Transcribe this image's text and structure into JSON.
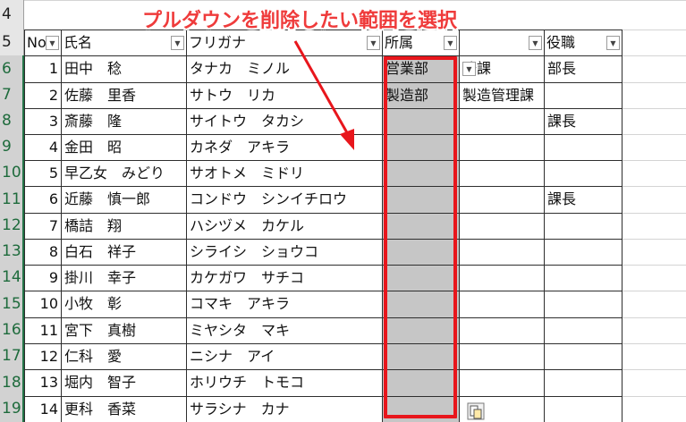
{
  "annotation": {
    "text": "プルダウンを削除したい範囲を選択",
    "color": "#e8161c"
  },
  "row_numbers": [
    "4",
    "5",
    "6",
    "7",
    "8",
    "9",
    "10",
    "11",
    "12",
    "13",
    "14",
    "15",
    "16",
    "17",
    "18",
    "19"
  ],
  "header": {
    "no": "No",
    "name": "氏名",
    "furigana": "フリガナ",
    "dept": "所属",
    "section": "",
    "title": "役職"
  },
  "rows": [
    {
      "no": "1",
      "name": "田中　稔",
      "kana": "タナカ　ミノル",
      "dept": "営業部",
      "section": "務課",
      "title": "部長"
    },
    {
      "no": "2",
      "name": "佐藤　里香",
      "kana": "サトウ　リカ",
      "dept": "製造部",
      "section": "製造管理課",
      "title": ""
    },
    {
      "no": "3",
      "name": "斎藤　隆",
      "kana": "サイトウ　タカシ",
      "dept": "",
      "section": "",
      "title": "課長"
    },
    {
      "no": "4",
      "name": "金田　昭",
      "kana": "カネダ　アキラ",
      "dept": "",
      "section": "",
      "title": ""
    },
    {
      "no": "5",
      "name": "早乙女　みどり",
      "kana": "サオトメ　ミドリ",
      "dept": "",
      "section": "",
      "title": ""
    },
    {
      "no": "6",
      "name": "近藤　慎一郎",
      "kana": "コンドウ　シンイチロウ",
      "dept": "",
      "section": "",
      "title": "課長"
    },
    {
      "no": "7",
      "name": "橋詰　翔",
      "kana": "ハシヅメ　カケル",
      "dept": "",
      "section": "",
      "title": ""
    },
    {
      "no": "8",
      "name": "白石　祥子",
      "kana": "シライシ　ショウコ",
      "dept": "",
      "section": "",
      "title": ""
    },
    {
      "no": "9",
      "name": "掛川　幸子",
      "kana": "カケガワ　サチコ",
      "dept": "",
      "section": "",
      "title": ""
    },
    {
      "no": "10",
      "name": "小牧　彰",
      "kana": "コマキ　アキラ",
      "dept": "",
      "section": "",
      "title": ""
    },
    {
      "no": "11",
      "name": "宮下　真樹",
      "kana": "ミヤシタ　マキ",
      "dept": "",
      "section": "",
      "title": ""
    },
    {
      "no": "12",
      "name": "仁科　愛",
      "kana": "ニシナ　アイ",
      "dept": "",
      "section": "",
      "title": ""
    },
    {
      "no": "13",
      "name": "堀内　智子",
      "kana": "ホリウチ　トモコ",
      "dept": "",
      "section": "",
      "title": ""
    },
    {
      "no": "14",
      "name": "更科　香菜",
      "kana": "サラシナ　カナ",
      "dept": "",
      "section": "",
      "title": ""
    }
  ]
}
